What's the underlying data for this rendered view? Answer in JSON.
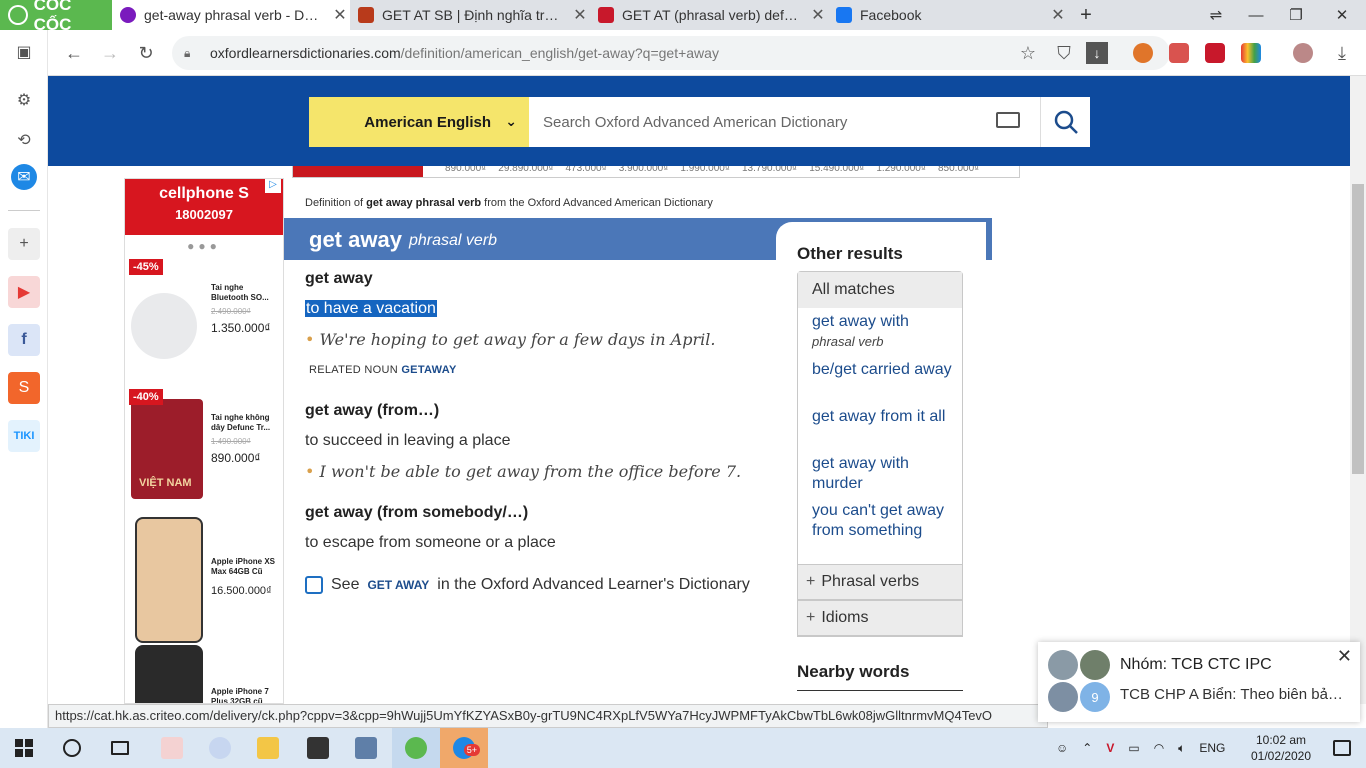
{
  "browser": {
    "brand": "CỐC CỐC",
    "tabs": [
      {
        "title": "get-away phrasal verb - Defin",
        "color": "#7a1bbd"
      },
      {
        "title": "GET AT SB | Định nghĩa trong",
        "color": "#b83a1b"
      },
      {
        "title": "GET AT (phrasal verb) definitic",
        "color": "#c8182b"
      },
      {
        "title": "Facebook",
        "color": "#1877f2"
      }
    ],
    "url_domain": "oxfordlearnersdictionaries.com",
    "url_path": "/definition/american_english/get-away?q=get+away"
  },
  "header": {
    "language": "American English",
    "search_placeholder": "Search Oxford Advanced American Dictionary"
  },
  "ad_strip": [
    "890.000₫",
    "29.890.000₫",
    "473.000₫",
    "3.900.000₫",
    "1.990.000₫",
    "13.790.000₫",
    "15.490.000₫",
    "1.290.000₫",
    "850.000₫"
  ],
  "left_ad": {
    "brand": "cellphone S",
    "phone": "18002097",
    "products": [
      {
        "discount": "-45%",
        "name": "Tai nghe Bluetooth SO...",
        "old": "2.490.000₫",
        "price": "1.350.000₫",
        "color": "#e9eaec"
      },
      {
        "discount": "-40%",
        "name": "Tai nghe không dây Defunc Tr...",
        "old": "1.490.000₫",
        "price": "890.000₫",
        "color": "#9c1d2a",
        "label": "VIỆT NAM"
      },
      {
        "discount": "",
        "name": "Apple iPhone XS Max 64GB Cũ",
        "old": "",
        "price": "16.500.000₫",
        "color": "#e8c7a0"
      },
      {
        "discount": "",
        "name": "Apple iPhone 7 Plus 32GB cũ",
        "old": "",
        "price": "",
        "color": "#2a2a2a"
      }
    ]
  },
  "entry": {
    "crumb_prefix": "Definition of",
    "crumb_term": "get away phrasal verb",
    "crumb_suffix": "from the Oxford Advanced American Dictionary",
    "headword": "get away",
    "pos": "phrasal verb",
    "senses": [
      {
        "head": "get away",
        "def": "to have a vacation",
        "ex": "We're hoping to get away for a few days in April.",
        "related_label": "RELATED NOUN",
        "related": "GETAWAY"
      },
      {
        "head": "get away (from…)",
        "def": "to succeed in leaving a place",
        "ex": "I won't be able to get away from the office before 7."
      },
      {
        "head": "get away (from somebody/…)",
        "def": "to escape from someone or a place"
      }
    ],
    "see_prefix": "See",
    "see_term": "GET AWAY",
    "see_suffix": "in the Oxford Advanced Learner's Dictionary"
  },
  "other_results": {
    "title": "Other results",
    "all_matches": "All matches",
    "links": [
      {
        "text": "get away with",
        "sub": "phrasal verb"
      },
      {
        "text": "be/get carried away",
        "sub": ""
      },
      {
        "text": "get away from it all",
        "sub": ""
      },
      {
        "text": "get away with murder",
        "sub": ""
      },
      {
        "text": "you can't get away from something",
        "sub": ""
      }
    ],
    "phrasal_verbs": "Phrasal verbs",
    "idioms": "Idioms",
    "nearby": "Nearby words"
  },
  "status_url": "https://cat.hk.as.criteo.com/delivery/ck.php?cppv=3&cpp=9hWujj5UmYfKZYASxB0y-grTU9NC4RXpLfV5WYa7HcyJWPMFTyAkCbwTbL6wk08jwGlltnrmvMQ4TevO",
  "toast": {
    "group": "Nhóm: TCB CTC IPC",
    "message": "TCB CHP A Biển: Theo biên bản g...",
    "count": "9"
  },
  "taskbar": {
    "lang": "ENG",
    "time": "10:02 am",
    "date": "01/02/2020",
    "zalo_badge": "5+"
  }
}
